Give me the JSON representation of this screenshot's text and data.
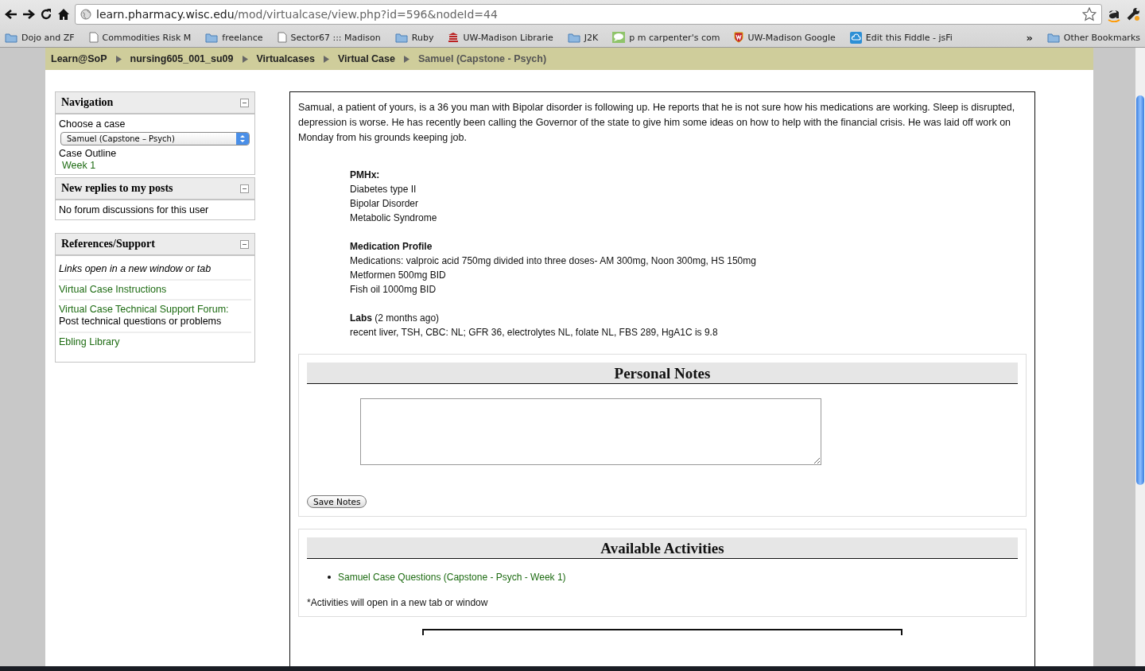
{
  "browser": {
    "address": {
      "host": "learn.pharmacy.wisc.edu",
      "path": "/mod/virtualcase/view.php?id=596&nodeId=44"
    },
    "bookmarks": [
      {
        "label": "Dojo and ZF",
        "kind": "folder"
      },
      {
        "label": "Commodities Risk M",
        "kind": "page"
      },
      {
        "label": "freelance",
        "kind": "folder"
      },
      {
        "label": "Sector67 ::: Madison",
        "kind": "page"
      },
      {
        "label": "Ruby",
        "kind": "folder"
      },
      {
        "label": "UW-Madison Librarie",
        "kind": "library"
      },
      {
        "label": "J2K",
        "kind": "folder"
      },
      {
        "label": "p m carpenter's com",
        "kind": "chat"
      },
      {
        "label": "UW-Madison Google",
        "kind": "shield"
      },
      {
        "label": "Edit this Fiddle - jsFi",
        "kind": "cloud"
      }
    ],
    "overflow": "»",
    "other_bookmarks": "Other Bookmarks"
  },
  "breadcrumb": [
    {
      "label": "Learn@SoP",
      "current": false
    },
    {
      "label": "nursing605_001_su09",
      "current": false
    },
    {
      "label": "Virtualcases",
      "current": false
    },
    {
      "label": "Virtual Case",
      "current": false
    },
    {
      "label": "Samuel (Capstone - Psych)",
      "current": true
    }
  ],
  "navigation": {
    "title": "Navigation",
    "choose_label": "Choose a case",
    "case_select": "Samuel (Capstone – Psych)",
    "outline_label": "Case Outline",
    "weeks": [
      "Week 1"
    ]
  },
  "replies": {
    "title": "New replies to my posts",
    "message": "No forum discussions for this user"
  },
  "references": {
    "title": "References/Support",
    "note": "Links open in a new window or tab",
    "links": [
      {
        "label": "Virtual Case Instructions"
      },
      {
        "label": "Virtual Case Technical Support Forum:",
        "description": "Post technical questions or problems"
      },
      {
        "label": "Ebling Library"
      }
    ]
  },
  "case": {
    "intro": "Samual, a patient of yours, is a 36 you man with Bipolar disorder is following up. He reports that he is not sure how his medications are working. Sleep is disrupted, depression is worse. He has recently been calling the Governor of the state to give him some ideas on how to help with the financial crisis. He was laid off work on Monday from his grounds keeping job.",
    "sections": [
      {
        "heading": "PMHx:",
        "lines": [
          "Diabetes type II",
          "Bipolar Disorder",
          "Metabolic Syndrome"
        ]
      },
      {
        "heading": "Medication Profile",
        "lines": [
          "Medications: valproic acid 750mg divided into three doses- AM 300mg, Noon 300mg, HS 150mg",
          "Metformen 500mg BID",
          "Fish oil 1000mg BID"
        ]
      },
      {
        "heading": "Labs",
        "note": "(2 months ago)",
        "lines": [
          "recent liver, TSH, CBC: NL; GFR 36, electrolytes NL, folate NL, FBS 289, HgA1C is 9.8"
        ]
      }
    ]
  },
  "notes": {
    "title": "Personal Notes",
    "button": "Save Notes"
  },
  "activities": {
    "title": "Available Activities",
    "items": [
      "Samuel Case Questions (Capstone - Psych - Week 1)"
    ],
    "footnote": "*Activities will open in a new tab or window"
  }
}
